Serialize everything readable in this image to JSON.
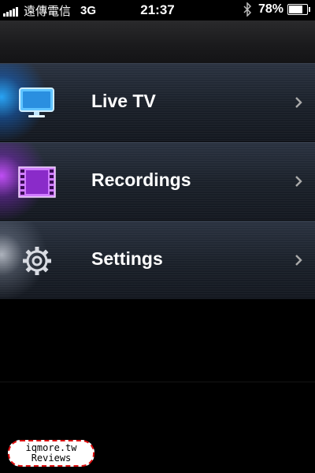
{
  "status_bar": {
    "carrier": "遠傳電信",
    "network": "3G",
    "time": "21:37",
    "battery_percent_label": "78%",
    "battery_level": 0.78,
    "bluetooth_icon": "bluetooth-icon"
  },
  "menu": {
    "items": [
      {
        "label": "Live TV",
        "icon": "tv-icon",
        "accent": "#29a8ff"
      },
      {
        "label": "Recordings",
        "icon": "film-icon",
        "accent": "#c45cff"
      },
      {
        "label": "Settings",
        "icon": "gear-icon",
        "accent": "#d8dce4"
      }
    ]
  },
  "watermark": {
    "line1": "iqmore.tw",
    "line2": "Reviews",
    "border_color": "#dd1111"
  }
}
